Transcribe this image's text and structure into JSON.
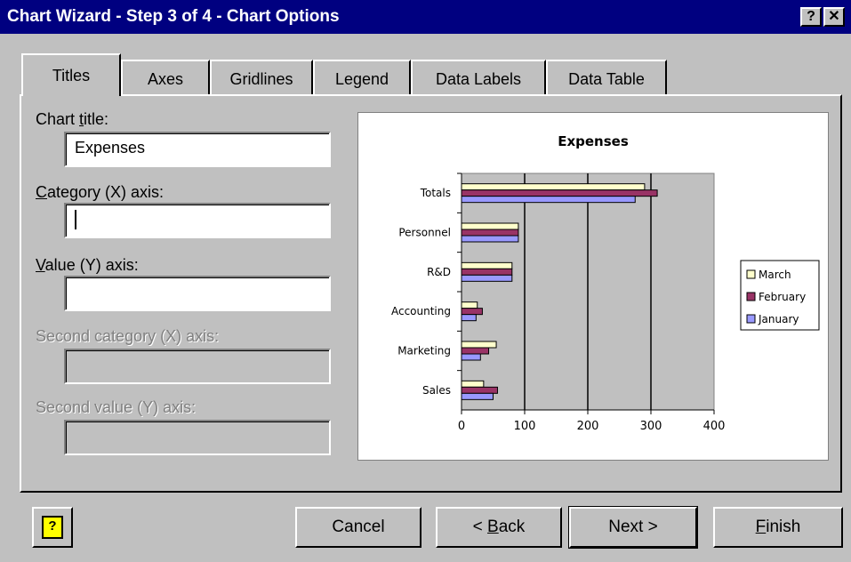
{
  "window": {
    "title": "Chart Wizard - Step 3 of 4 - Chart Options",
    "help_glyph": "?",
    "close_glyph": "✕"
  },
  "tabs": [
    {
      "label": "Titles",
      "active": true
    },
    {
      "label": "Axes"
    },
    {
      "label": "Gridlines"
    },
    {
      "label": "Legend"
    },
    {
      "label": "Data Labels"
    },
    {
      "label": "Data Table"
    }
  ],
  "fields": {
    "chart_title": {
      "label_pre": "Chart ",
      "label_u": "t",
      "label_post": "itle:",
      "value": "Expenses"
    },
    "category_x": {
      "label_pre": "",
      "label_u": "C",
      "label_post": "ategory (X) axis:",
      "value": ""
    },
    "value_y": {
      "label_pre": "",
      "label_u": "V",
      "label_post": "alue (Y) axis:",
      "value": ""
    },
    "second_category_x": {
      "label": "Second category (X) axis:",
      "value": ""
    },
    "second_value_y": {
      "label": "Second value (Y) axis:",
      "value": ""
    }
  },
  "chart_data": {
    "type": "bar",
    "orientation": "horizontal",
    "title": "Expenses",
    "categories": [
      "Sales",
      "Marketing",
      "Accounting",
      "R&D",
      "Personnel",
      "Totals"
    ],
    "series": [
      {
        "name": "March",
        "color": "#ffffcc",
        "values": [
          35,
          55,
          25,
          80,
          90,
          290
        ]
      },
      {
        "name": "February",
        "color": "#993366",
        "values": [
          57,
          43,
          33,
          80,
          90,
          310
        ]
      },
      {
        "name": "January",
        "color": "#9999ff",
        "values": [
          50,
          30,
          23,
          80,
          90,
          275
        ]
      }
    ],
    "xlim": [
      0,
      400
    ],
    "xticks": [
      "0",
      "100",
      "200",
      "300",
      "400"
    ],
    "plot_background": "#c0c0c0",
    "gridlines": true,
    "legend": "right"
  },
  "buttons": {
    "help_icon": "?",
    "cancel": "Cancel",
    "back_pre": "< ",
    "back_u": "B",
    "back_post": "ack",
    "next": "Next >",
    "finish_u": "F",
    "finish_post": "inish"
  }
}
